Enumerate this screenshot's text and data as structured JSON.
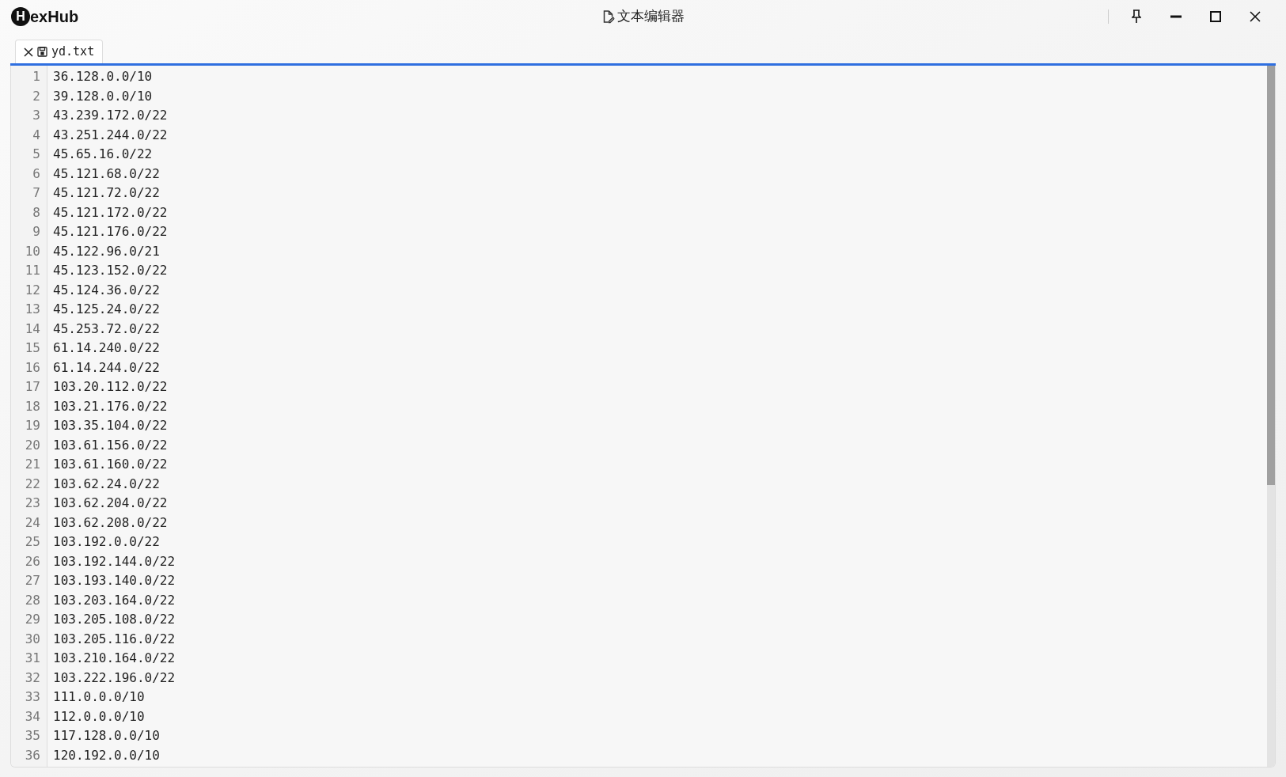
{
  "app": {
    "logo_letter": "H",
    "logo_text": "exHub"
  },
  "window": {
    "title": "文本编辑器"
  },
  "tabs": [
    {
      "label": "yd.txt",
      "selected": true
    }
  ],
  "editor": {
    "lines": [
      {
        "number": "1",
        "text": "36.128.0.0/10"
      },
      {
        "number": "2",
        "text": "39.128.0.0/10"
      },
      {
        "number": "3",
        "text": "43.239.172.0/22"
      },
      {
        "number": "4",
        "text": "43.251.244.0/22"
      },
      {
        "number": "5",
        "text": "45.65.16.0/22"
      },
      {
        "number": "6",
        "text": "45.121.68.0/22"
      },
      {
        "number": "7",
        "text": "45.121.72.0/22"
      },
      {
        "number": "8",
        "text": "45.121.172.0/22"
      },
      {
        "number": "9",
        "text": "45.121.176.0/22"
      },
      {
        "number": "10",
        "text": "45.122.96.0/21"
      },
      {
        "number": "11",
        "text": "45.123.152.0/22"
      },
      {
        "number": "12",
        "text": "45.124.36.0/22"
      },
      {
        "number": "13",
        "text": "45.125.24.0/22"
      },
      {
        "number": "14",
        "text": "45.253.72.0/22"
      },
      {
        "number": "15",
        "text": "61.14.240.0/22"
      },
      {
        "number": "16",
        "text": "61.14.244.0/22"
      },
      {
        "number": "17",
        "text": "103.20.112.0/22"
      },
      {
        "number": "18",
        "text": "103.21.176.0/22"
      },
      {
        "number": "19",
        "text": "103.35.104.0/22"
      },
      {
        "number": "20",
        "text": "103.61.156.0/22"
      },
      {
        "number": "21",
        "text": "103.61.160.0/22"
      },
      {
        "number": "22",
        "text": "103.62.24.0/22"
      },
      {
        "number": "23",
        "text": "103.62.204.0/22"
      },
      {
        "number": "24",
        "text": "103.62.208.0/22"
      },
      {
        "number": "25",
        "text": "103.192.0.0/22"
      },
      {
        "number": "26",
        "text": "103.192.144.0/22"
      },
      {
        "number": "27",
        "text": "103.193.140.0/22"
      },
      {
        "number": "28",
        "text": "103.203.164.0/22"
      },
      {
        "number": "29",
        "text": "103.205.108.0/22"
      },
      {
        "number": "30",
        "text": "103.205.116.0/22"
      },
      {
        "number": "31",
        "text": "103.210.164.0/22"
      },
      {
        "number": "32",
        "text": "103.222.196.0/22"
      },
      {
        "number": "33",
        "text": "111.0.0.0/10"
      },
      {
        "number": "34",
        "text": "112.0.0.0/10"
      },
      {
        "number": "35",
        "text": "117.128.0.0/10"
      },
      {
        "number": "36",
        "text": "120.192.0.0/10"
      }
    ]
  }
}
